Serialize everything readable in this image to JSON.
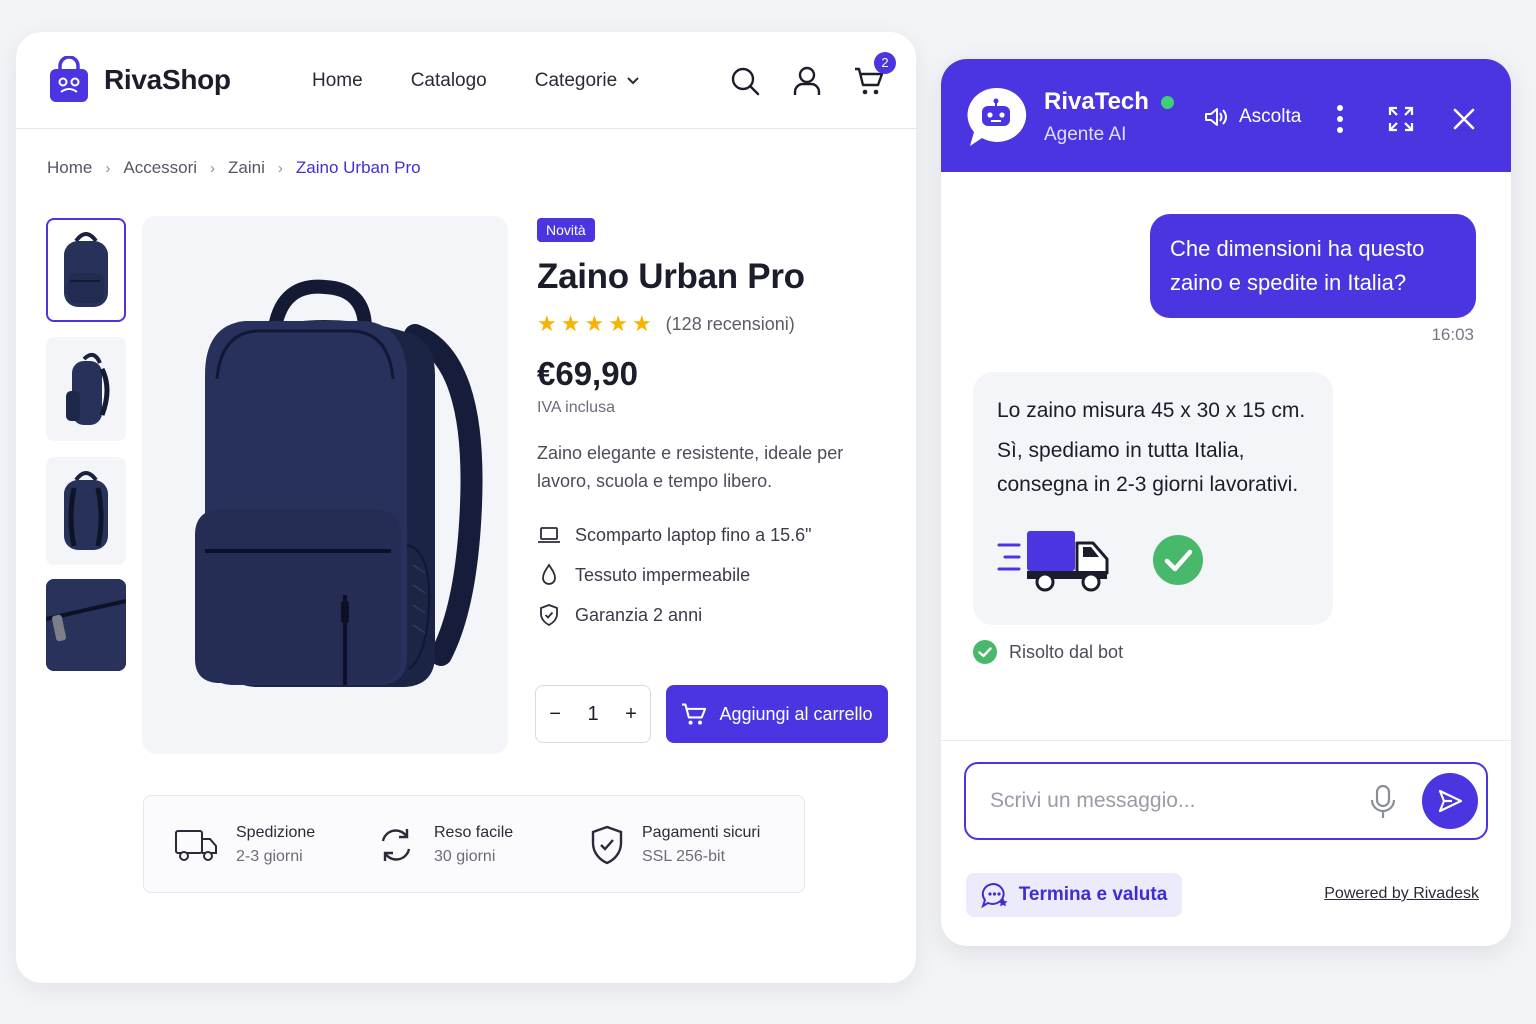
{
  "shop": {
    "brand": "RivaShop",
    "nav": [
      "Home",
      "Catalogo",
      "Categorie"
    ],
    "cart_count": "2",
    "breadcrumbs": [
      "Home",
      "Accessori",
      "Zaini",
      "Zaino Urban Pro"
    ],
    "product": {
      "badge": "Novità",
      "title": "Zaino Urban Pro",
      "rating": 5,
      "reviews": "(128 recensioni)",
      "price": "€69,90",
      "vat": "IVA inclusa",
      "description": "Zaino elegante e resistente, ideale per lavoro, scuola e tempo libero.",
      "features": [
        {
          "icon": "laptop-icon",
          "text": "Scomparto laptop fino a 15.6\""
        },
        {
          "icon": "water-drop-icon",
          "text": "Tessuto impermeabile"
        },
        {
          "icon": "shield-check-icon",
          "text": "Garanzia 2 anni"
        }
      ],
      "quantity": "1",
      "add_to_cart": "Aggiungi al carrello"
    },
    "perks": [
      {
        "icon": "truck-icon",
        "title": "Spedizione",
        "subtitle": "2-3 giorni"
      },
      {
        "icon": "refresh-icon",
        "title": "Reso facile",
        "subtitle": "30 giorni"
      },
      {
        "icon": "shield-check-icon",
        "title": "Pagamenti sicuri",
        "subtitle": "SSL 256-bit"
      }
    ]
  },
  "chat": {
    "agent_name": "RivaTech",
    "agent_role": "Agente AI",
    "listen_label": "Ascolta",
    "user_message": "Che dimensioni ha questo zaino e spedite in Italia?",
    "user_time": "16:03",
    "bot_message_1": "Lo zaino misura 45 x 30 x 15 cm.",
    "bot_message_2": "Sì, spediamo in tutta Italia, consegna in 2-3 giorni lavorativi.",
    "resolved_label": "Risolto dal bot",
    "input_placeholder": "Scrivi un messaggio...",
    "end_button": "Termina e valuta",
    "powered_by": "Powered by Rivadesk"
  },
  "colors": {
    "accent": "#4a35e0",
    "success": "#3fcf77",
    "star": "#f5b400"
  }
}
